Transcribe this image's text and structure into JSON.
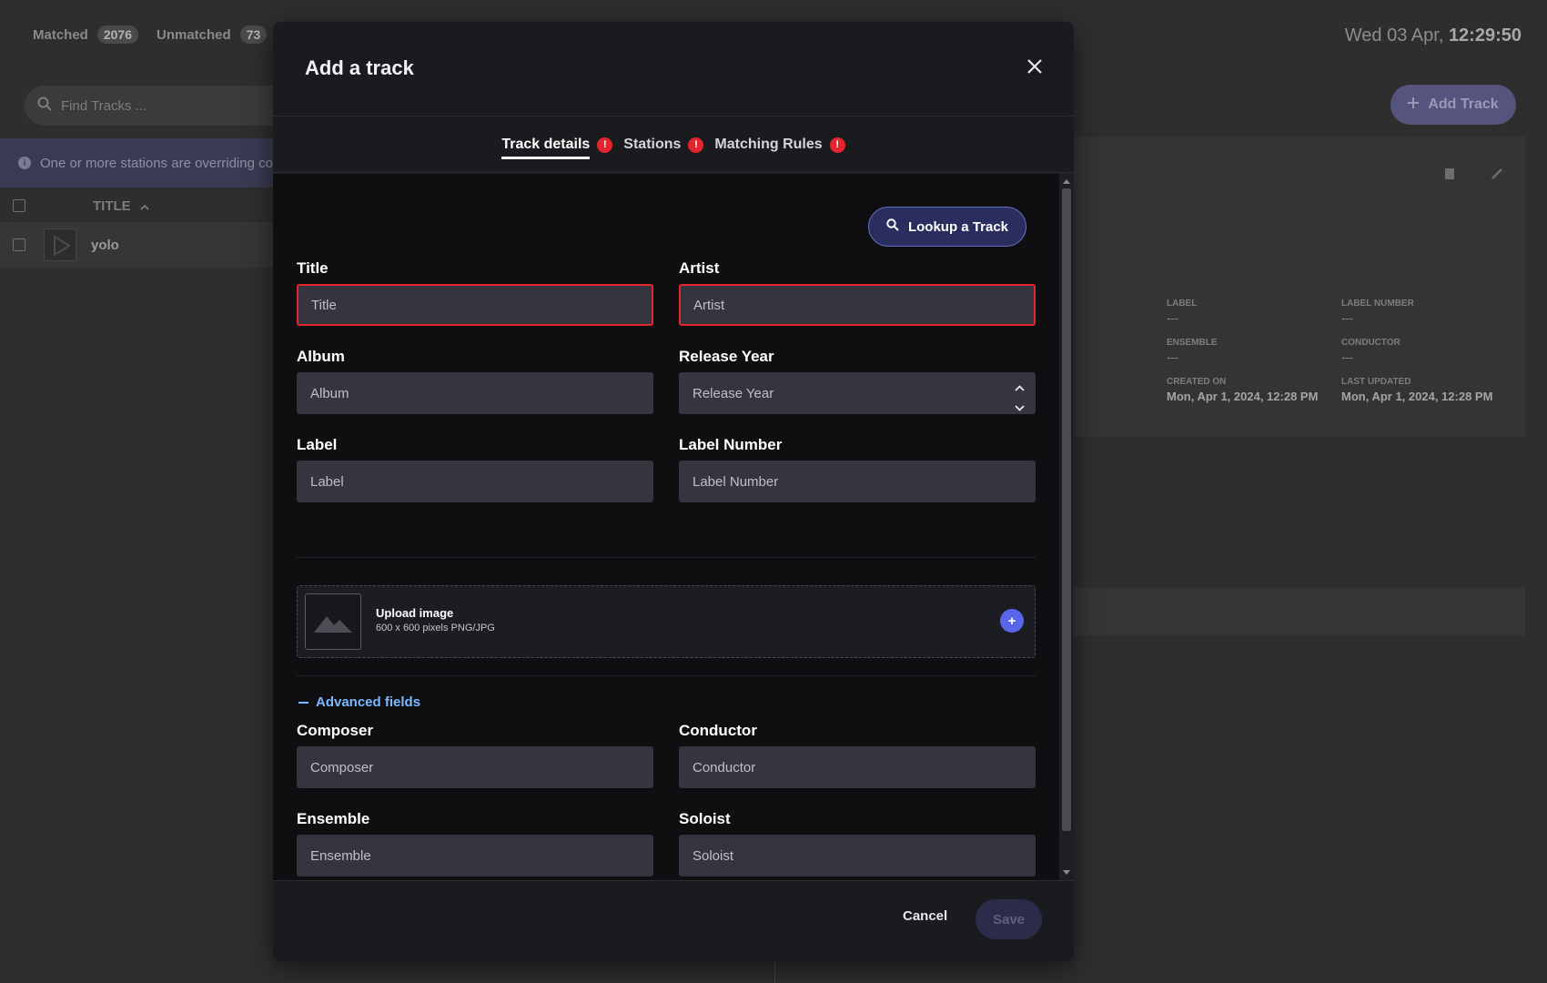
{
  "background": {
    "counts": {
      "matched_label": "Matched",
      "matched_count": "2076",
      "unmatched_label": "Unmatched",
      "unmatched_count": "73"
    },
    "clock": {
      "date": "Wed 03 Apr,",
      "time": "12:29:50"
    },
    "search_placeholder": "Find Tracks ...",
    "add_track_label": "Add Track",
    "info_text": "One or more stations are overriding co",
    "table": {
      "title_header": "TITLE",
      "row_title": "yolo"
    },
    "details": [
      {
        "label": "LABEL",
        "value": "---"
      },
      {
        "label": "LABEL NUMBER",
        "value": "---"
      },
      {
        "label": "ENSEMBLE",
        "value": "---"
      },
      {
        "label": "CONDUCTOR",
        "value": "---"
      },
      {
        "label": "CREATED ON",
        "value": "Mon, Apr 1, 2024, 12:28 PM"
      },
      {
        "label": "LAST UPDATED",
        "value": "Mon, Apr 1, 2024, 12:28 PM"
      }
    ]
  },
  "modal": {
    "title": "Add a track",
    "tabs": [
      {
        "label": "Track details",
        "badge": "!",
        "active": true
      },
      {
        "label": "Stations",
        "badge": "!"
      },
      {
        "label": "Matching Rules",
        "badge": "!"
      }
    ],
    "lookup_label": "Lookup a Track",
    "fields": {
      "title": {
        "label": "Title",
        "placeholder": "Title"
      },
      "artist": {
        "label": "Artist",
        "placeholder": "Artist"
      },
      "album": {
        "label": "Album",
        "placeholder": "Album"
      },
      "release_year": {
        "label": "Release Year",
        "placeholder": "Release Year"
      },
      "label": {
        "label": "Label",
        "placeholder": "Label"
      },
      "label_number": {
        "label": "Label Number",
        "placeholder": "Label Number"
      },
      "composer": {
        "label": "Composer",
        "placeholder": "Composer"
      },
      "conductor": {
        "label": "Conductor",
        "placeholder": "Conductor"
      },
      "ensemble": {
        "label": "Ensemble",
        "placeholder": "Ensemble"
      },
      "soloist": {
        "label": "Soloist",
        "placeholder": "Soloist"
      }
    },
    "upload": {
      "title": "Upload image",
      "subtitle": "600 x 600 pixels PNG/JPG",
      "add_symbol": "+"
    },
    "advanced_label": "Advanced fields",
    "footer": {
      "cancel_label": "Cancel",
      "save_label": "Save"
    }
  },
  "colors": {
    "accent": "#5966ea",
    "error": "#e5252e",
    "link": "#7ab8ff"
  },
  "icons": [
    "search-icon",
    "plus-icon",
    "info-icon",
    "close-icon",
    "image-placeholder-icon",
    "chevron-up-icon",
    "chevron-down-icon",
    "delete-icon",
    "edit-icon",
    "sort-asc-icon"
  ]
}
